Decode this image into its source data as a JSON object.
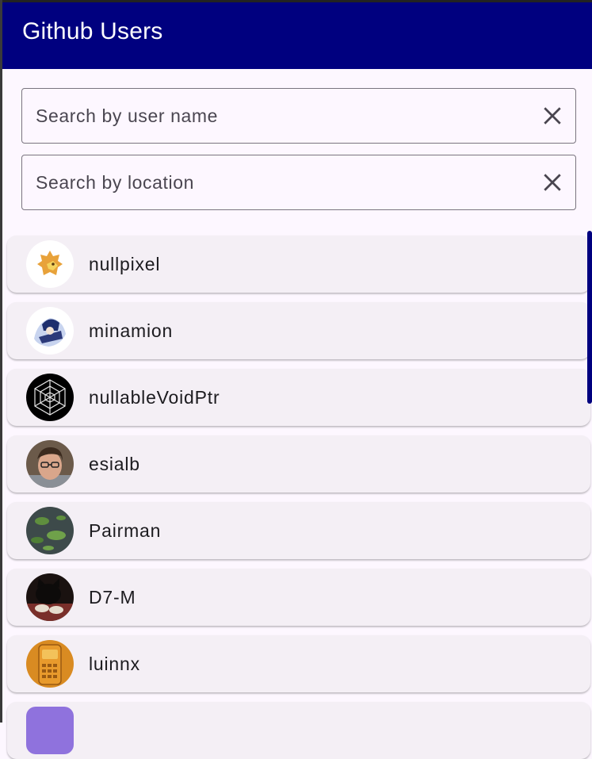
{
  "appbar": {
    "title": "Github Users"
  },
  "search": {
    "username_placeholder": "Search by user name",
    "username_value": "",
    "location_placeholder": "Search by location",
    "location_value": "",
    "clear_icon": "close-icon"
  },
  "users": [
    {
      "login": "nullpixel",
      "avatar": "lion-avatar"
    },
    {
      "login": "minamion",
      "avatar": "anime-avatar"
    },
    {
      "login": "nullableVoidPtr",
      "avatar": "geometric-avatar"
    },
    {
      "login": "esialb",
      "avatar": "photo-avatar"
    },
    {
      "login": "Pairman",
      "avatar": "lily-pad-avatar"
    },
    {
      "login": "D7-M",
      "avatar": "cat-avatar"
    },
    {
      "login": "luinnx",
      "avatar": "orange-avatar"
    },
    {
      "login": "",
      "avatar": "purple-avatar"
    }
  ],
  "colors": {
    "appbar": "#00007f",
    "background": "#fdf7ff",
    "card": "#f4eff5",
    "scrollbar": "#00007f"
  }
}
